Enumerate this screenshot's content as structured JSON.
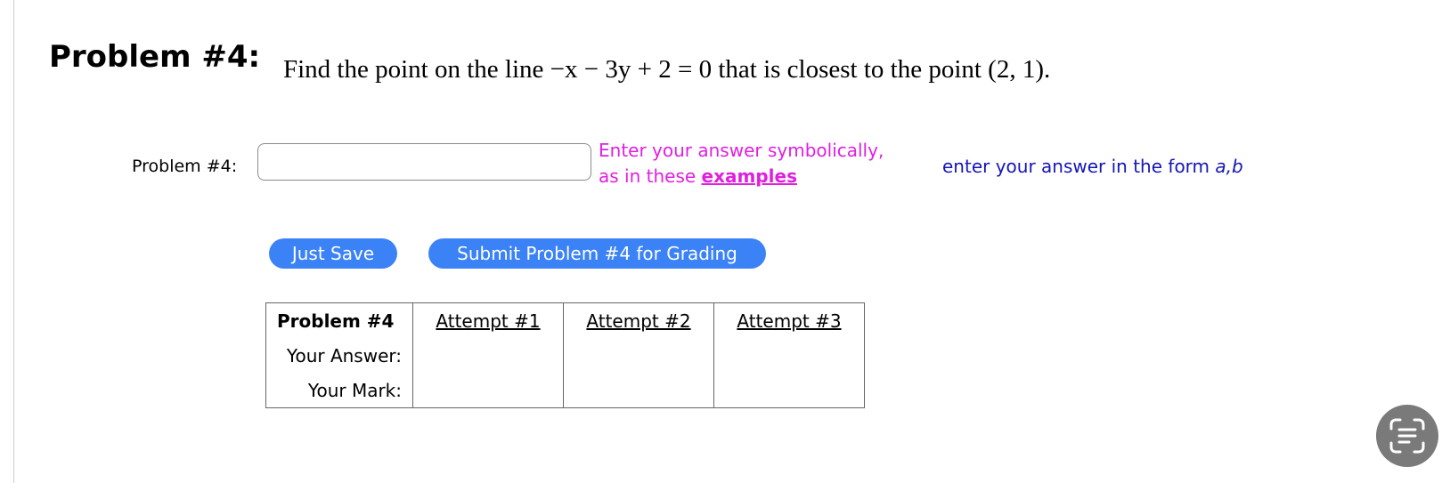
{
  "problem": {
    "title": "Problem #4:",
    "text_prefix": "Find the point on the line ",
    "equation": "−x − 3y + 2 = 0",
    "text_suffix": " that is closest to the point (2, 1)."
  },
  "answer": {
    "label": "Problem #4:",
    "value": "",
    "hint_line1": "Enter your answer symbolically,",
    "hint_line2": "as in these ",
    "hint_link": "examples",
    "form_hint_prefix": "enter your answer in the form ",
    "form_hint_var": "a,b"
  },
  "buttons": {
    "save_label": "Just Save",
    "submit_label": "Submit Problem #4 for Grading"
  },
  "attempts_table": {
    "header": "Problem #4",
    "columns": [
      "Attempt #1",
      "Attempt #2",
      "Attempt #3"
    ],
    "row_answer_label": "Your Answer:",
    "row_mark_label": "Your Mark:"
  },
  "colors": {
    "accent": "#3b82f6",
    "hint": "#e020e0",
    "form_hint": "#1515b8"
  },
  "icons": {
    "floating_button": "text-scan-icon"
  }
}
